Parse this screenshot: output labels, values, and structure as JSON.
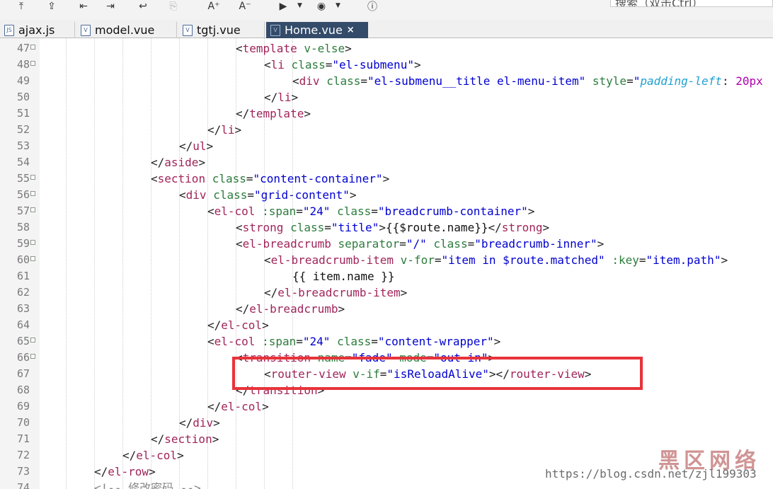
{
  "toolbar": {
    "buttons": [
      {
        "name": "upload-icon",
        "glyph": "⤒"
      },
      {
        "name": "import-icon",
        "glyph": "⇪"
      },
      {
        "name": "indent-left-icon",
        "glyph": "⇤"
      },
      {
        "name": "indent-right-icon",
        "glyph": "⇥"
      },
      {
        "name": "wrap-icon",
        "glyph": "↩"
      },
      {
        "name": "copy-icon",
        "glyph": "⎘"
      },
      {
        "name": "font-larger-icon",
        "glyph": "A⁺"
      },
      {
        "name": "font-smaller-icon",
        "glyph": "A⁻"
      },
      {
        "name": "run-icon",
        "glyph": "▶"
      },
      {
        "name": "browser-icon",
        "glyph": "◉"
      },
      {
        "name": "info-icon",
        "glyph": "ⓘ"
      }
    ],
    "search_text": "搜索（双击Ctrl）"
  },
  "tabs": [
    {
      "label": "ajax.js",
      "icon": "JS",
      "active": false
    },
    {
      "label": "model.vue",
      "icon": "V",
      "active": false
    },
    {
      "label": "tgtj.vue",
      "icon": "V",
      "active": false
    },
    {
      "label": "Home.vue",
      "icon": "V",
      "active": true
    }
  ],
  "tab_close": "×",
  "lines": [
    {
      "n": "47",
      "fold": true,
      "indent": 7,
      "tokens": [
        [
          "p",
          "<"
        ],
        [
          "t",
          "template"
        ],
        [
          "x",
          " "
        ],
        [
          "a",
          "v-else"
        ],
        [
          "p",
          ">"
        ]
      ]
    },
    {
      "n": "48",
      "fold": true,
      "indent": 8,
      "tokens": [
        [
          "p",
          "<"
        ],
        [
          "t",
          "li"
        ],
        [
          "x",
          " "
        ],
        [
          "a",
          "class"
        ],
        [
          "p",
          "="
        ],
        [
          "s",
          "\"el-submenu\""
        ],
        [
          "p",
          ">"
        ]
      ]
    },
    {
      "n": "49",
      "fold": false,
      "indent": 9,
      "tokens": [
        [
          "p",
          "<"
        ],
        [
          "t",
          "div"
        ],
        [
          "x",
          " "
        ],
        [
          "a",
          "class"
        ],
        [
          "p",
          "="
        ],
        [
          "s",
          "\"el-submenu__title el-menu-item\""
        ],
        [
          "x",
          " "
        ],
        [
          "a",
          "style"
        ],
        [
          "p",
          "="
        ],
        [
          "s",
          "\""
        ],
        [
          "ci",
          "padding-left"
        ],
        [
          "p",
          ": "
        ],
        [
          "cn",
          "20px"
        ]
      ]
    },
    {
      "n": "50",
      "fold": false,
      "indent": 8,
      "tokens": [
        [
          "p",
          "</"
        ],
        [
          "t",
          "li"
        ],
        [
          "p",
          ">"
        ]
      ]
    },
    {
      "n": "51",
      "fold": false,
      "indent": 7,
      "tokens": [
        [
          "p",
          "</"
        ],
        [
          "t",
          "template"
        ],
        [
          "p",
          ">"
        ]
      ]
    },
    {
      "n": "52",
      "fold": false,
      "indent": 6,
      "tokens": [
        [
          "p",
          "</"
        ],
        [
          "t",
          "li"
        ],
        [
          "p",
          ">"
        ]
      ]
    },
    {
      "n": "53",
      "fold": false,
      "indent": 5,
      "tokens": [
        [
          "p",
          "</"
        ],
        [
          "t",
          "ul"
        ],
        [
          "p",
          ">"
        ]
      ]
    },
    {
      "n": "54",
      "fold": false,
      "indent": 4,
      "tokens": [
        [
          "p",
          "</"
        ],
        [
          "t",
          "aside"
        ],
        [
          "p",
          ">"
        ]
      ]
    },
    {
      "n": "55",
      "fold": true,
      "indent": 4,
      "tokens": [
        [
          "p",
          "<"
        ],
        [
          "t",
          "section"
        ],
        [
          "x",
          " "
        ],
        [
          "a",
          "class"
        ],
        [
          "p",
          "="
        ],
        [
          "s",
          "\"content-container\""
        ],
        [
          "p",
          ">"
        ]
      ]
    },
    {
      "n": "56",
      "fold": true,
      "indent": 5,
      "tokens": [
        [
          "p",
          "<"
        ],
        [
          "t",
          "div"
        ],
        [
          "x",
          " "
        ],
        [
          "a",
          "class"
        ],
        [
          "p",
          "="
        ],
        [
          "s",
          "\"grid-content\""
        ],
        [
          "p",
          ">"
        ]
      ]
    },
    {
      "n": "57",
      "fold": true,
      "indent": 6,
      "tokens": [
        [
          "p",
          "<"
        ],
        [
          "t",
          "el-col"
        ],
        [
          "x",
          " "
        ],
        [
          "a",
          ":span"
        ],
        [
          "p",
          "="
        ],
        [
          "s",
          "\"24\""
        ],
        [
          "x",
          " "
        ],
        [
          "a",
          "class"
        ],
        [
          "p",
          "="
        ],
        [
          "s",
          "\"breadcrumb-container\""
        ],
        [
          "p",
          ">"
        ]
      ]
    },
    {
      "n": "58",
      "fold": false,
      "indent": 7,
      "tokens": [
        [
          "p",
          "<"
        ],
        [
          "t",
          "strong"
        ],
        [
          "x",
          " "
        ],
        [
          "a",
          "class"
        ],
        [
          "p",
          "="
        ],
        [
          "s",
          "\"title\""
        ],
        [
          "p",
          ">"
        ],
        [
          "x",
          "{{$route.name}}"
        ],
        [
          "p",
          "</"
        ],
        [
          "t",
          "strong"
        ],
        [
          "p",
          ">"
        ]
      ]
    },
    {
      "n": "59",
      "fold": true,
      "indent": 7,
      "tokens": [
        [
          "p",
          "<"
        ],
        [
          "t",
          "el-breadcrumb"
        ],
        [
          "x",
          " "
        ],
        [
          "a",
          "separator"
        ],
        [
          "p",
          "="
        ],
        [
          "s",
          "\"/\""
        ],
        [
          "x",
          " "
        ],
        [
          "a",
          "class"
        ],
        [
          "p",
          "="
        ],
        [
          "s",
          "\"breadcrumb-inner\""
        ],
        [
          "p",
          ">"
        ]
      ]
    },
    {
      "n": "60",
      "fold": true,
      "indent": 8,
      "tokens": [
        [
          "p",
          "<"
        ],
        [
          "t",
          "el-breadcrumb-item"
        ],
        [
          "x",
          " "
        ],
        [
          "a",
          "v-for"
        ],
        [
          "p",
          "="
        ],
        [
          "s",
          "\"item in $route.matched\""
        ],
        [
          "x",
          " "
        ],
        [
          "a",
          ":key"
        ],
        [
          "p",
          "="
        ],
        [
          "s",
          "\"item.path\""
        ],
        [
          "p",
          ">"
        ]
      ]
    },
    {
      "n": "61",
      "fold": false,
      "indent": 9,
      "tokens": [
        [
          "x",
          "{{ item.name }}"
        ]
      ]
    },
    {
      "n": "62",
      "fold": false,
      "indent": 8,
      "tokens": [
        [
          "p",
          "</"
        ],
        [
          "t",
          "el-breadcrumb-item"
        ],
        [
          "p",
          ">"
        ]
      ]
    },
    {
      "n": "63",
      "fold": false,
      "indent": 7,
      "tokens": [
        [
          "p",
          "</"
        ],
        [
          "t",
          "el-breadcrumb"
        ],
        [
          "p",
          ">"
        ]
      ]
    },
    {
      "n": "64",
      "fold": false,
      "indent": 6,
      "tokens": [
        [
          "p",
          "</"
        ],
        [
          "t",
          "el-col"
        ],
        [
          "p",
          ">"
        ]
      ]
    },
    {
      "n": "65",
      "fold": true,
      "indent": 6,
      "tokens": [
        [
          "p",
          "<"
        ],
        [
          "t",
          "el-col"
        ],
        [
          "x",
          " "
        ],
        [
          "a",
          ":span"
        ],
        [
          "p",
          "="
        ],
        [
          "s",
          "\"24\""
        ],
        [
          "x",
          " "
        ],
        [
          "a",
          "class"
        ],
        [
          "p",
          "="
        ],
        [
          "s",
          "\"content-wrapper\""
        ],
        [
          "p",
          ">"
        ]
      ]
    },
    {
      "n": "66",
      "fold": true,
      "indent": 7,
      "tokens": [
        [
          "p",
          "<"
        ],
        [
          "t",
          "transition"
        ],
        [
          "x",
          " "
        ],
        [
          "a",
          "name"
        ],
        [
          "p",
          "="
        ],
        [
          "s",
          "\"fade\""
        ],
        [
          "x",
          " "
        ],
        [
          "a",
          "mode"
        ],
        [
          "p",
          "="
        ],
        [
          "s",
          "\"out-in\""
        ],
        [
          "p",
          ">"
        ]
      ]
    },
    {
      "n": "67",
      "fold": false,
      "indent": 8,
      "tokens": [
        [
          "p",
          "<"
        ],
        [
          "t",
          "router-view"
        ],
        [
          "x",
          " "
        ],
        [
          "a",
          "v-if"
        ],
        [
          "p",
          "="
        ],
        [
          "s",
          "\"isReloadAlive\""
        ],
        [
          "p",
          "></"
        ],
        [
          "t",
          "router-view"
        ],
        [
          "p",
          ">"
        ]
      ]
    },
    {
      "n": "68",
      "fold": false,
      "indent": 7,
      "tokens": [
        [
          "p",
          "</"
        ],
        [
          "t",
          "transition"
        ],
        [
          "p",
          ">"
        ]
      ]
    },
    {
      "n": "69",
      "fold": false,
      "indent": 6,
      "tokens": [
        [
          "p",
          "</"
        ],
        [
          "t",
          "el-col"
        ],
        [
          "p",
          ">"
        ]
      ]
    },
    {
      "n": "70",
      "fold": false,
      "indent": 5,
      "tokens": [
        [
          "p",
          "</"
        ],
        [
          "t",
          "div"
        ],
        [
          "p",
          ">"
        ]
      ]
    },
    {
      "n": "71",
      "fold": false,
      "indent": 4,
      "tokens": [
        [
          "p",
          "</"
        ],
        [
          "t",
          "section"
        ],
        [
          "p",
          ">"
        ]
      ]
    },
    {
      "n": "72",
      "fold": false,
      "indent": 3,
      "tokens": [
        [
          "p",
          "</"
        ],
        [
          "t",
          "el-col"
        ],
        [
          "p",
          ">"
        ]
      ]
    },
    {
      "n": "73",
      "fold": false,
      "indent": 2,
      "tokens": [
        [
          "p",
          "</"
        ],
        [
          "t",
          "el-row"
        ],
        [
          "p",
          ">"
        ]
      ]
    },
    {
      "n": "74",
      "fold": false,
      "indent": 2,
      "tokens": [
        [
          "cm",
          "<!-- 修改密码 -->"
        ]
      ]
    }
  ],
  "watermark": {
    "url": "https://blog.csdn.net/zjl199303",
    "brand": "黑区网络"
  }
}
